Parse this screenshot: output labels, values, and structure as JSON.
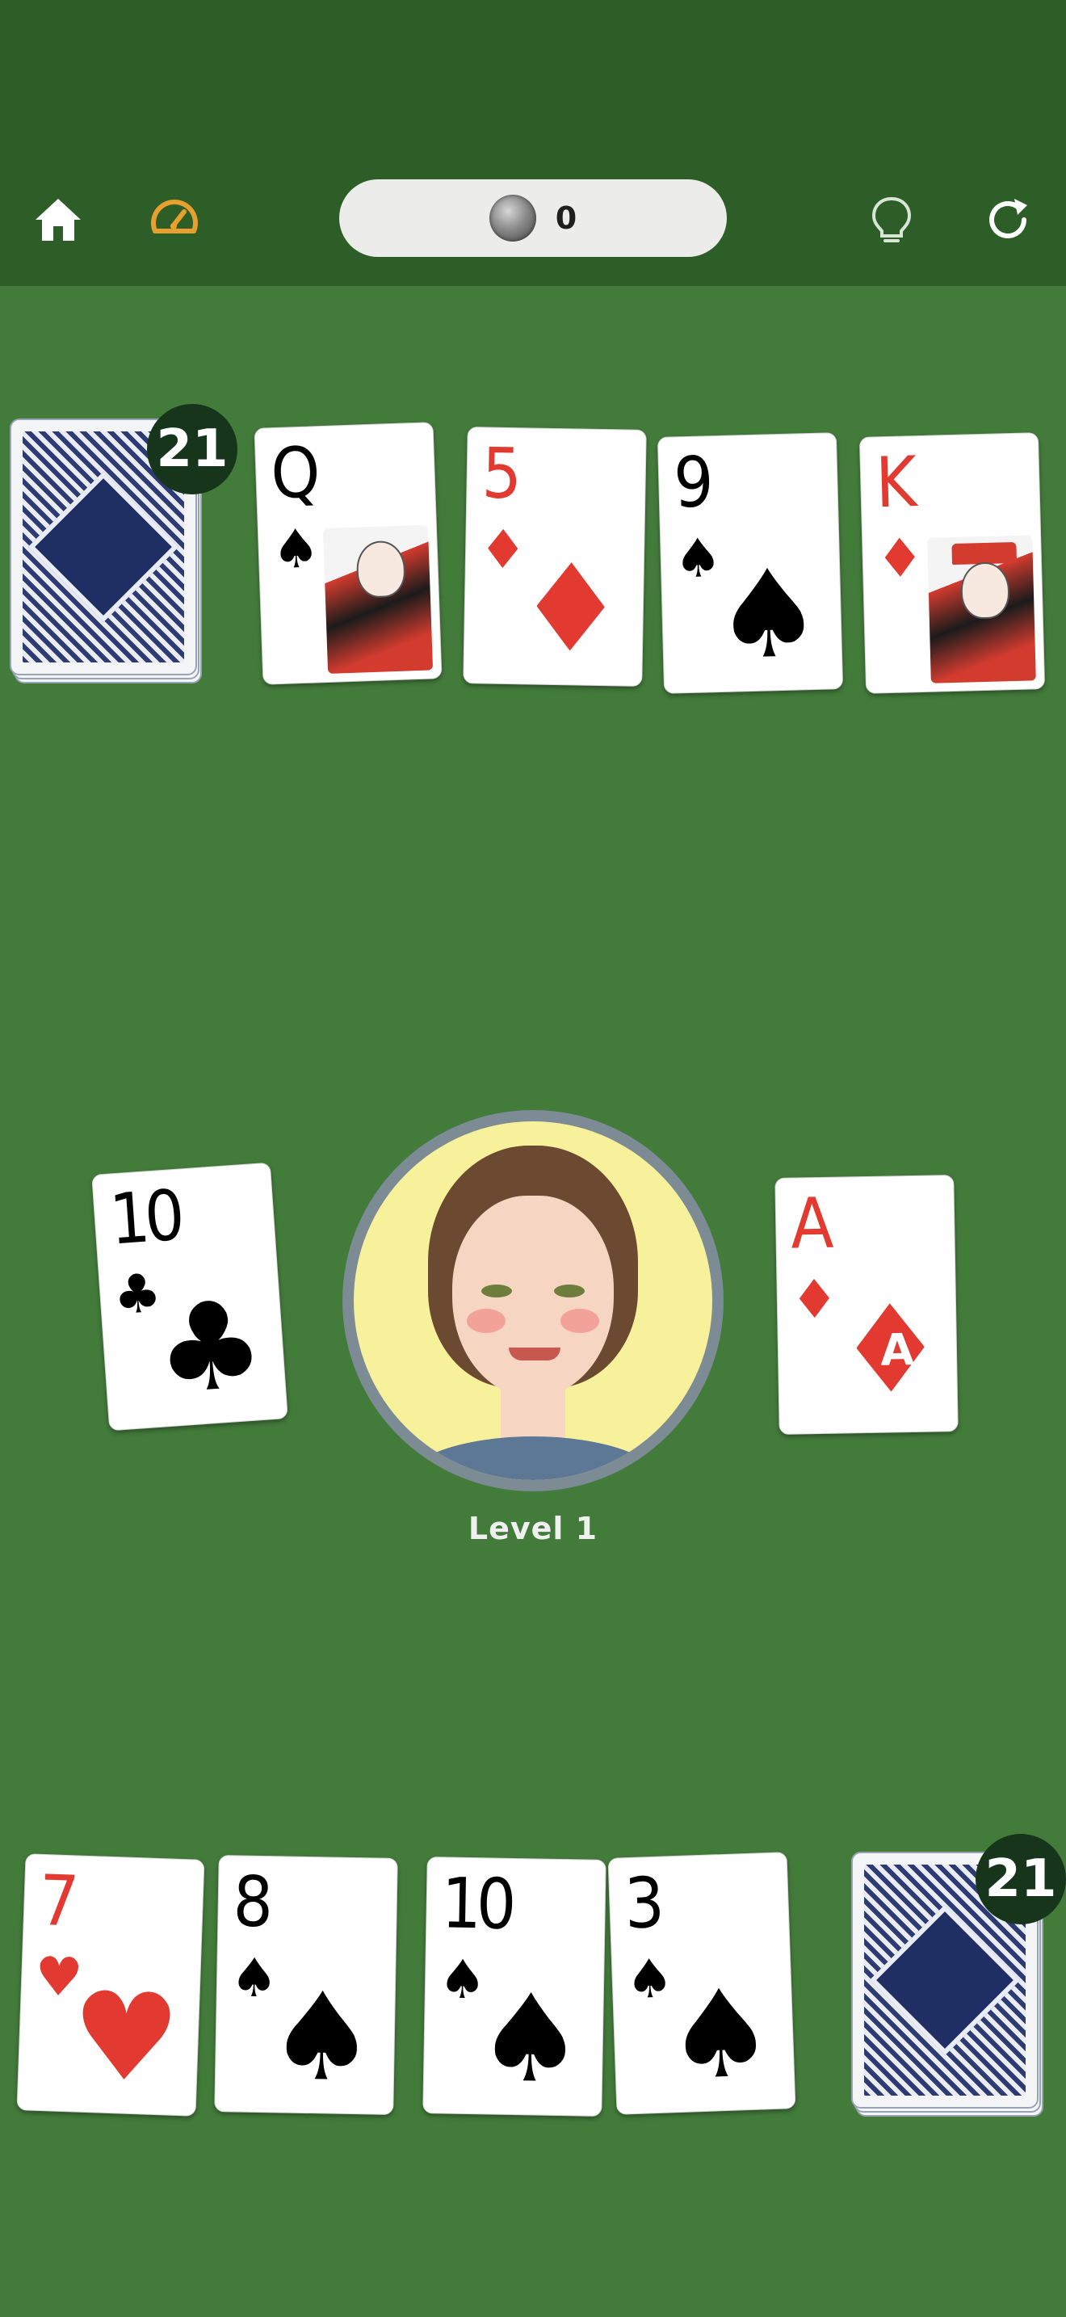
{
  "toolbar": {
    "home_icon": "home-icon",
    "speed_icon": "speedometer-icon",
    "hint_icon": "lightbulb-icon",
    "restart_icon": "refresh-icon",
    "coins": "0",
    "accent_color": "#e7a02d"
  },
  "opponent": {
    "deck_count": "21",
    "row": [
      {
        "rank": "Q",
        "suit": "♠",
        "color": "black",
        "face": true
      },
      {
        "rank": "5",
        "suit": "♦",
        "color": "red",
        "face": false
      },
      {
        "rank": "9",
        "suit": "♠",
        "color": "black",
        "face": false
      },
      {
        "rank": "K",
        "suit": "♦",
        "color": "red",
        "face": true
      }
    ]
  },
  "center": {
    "left_card": {
      "rank": "10",
      "suit": "♣",
      "color": "black"
    },
    "right_card": {
      "rank": "A",
      "suit": "♦",
      "color": "red",
      "center_glyph": "A"
    },
    "level_label": "Level 1"
  },
  "player": {
    "deck_count": "21",
    "hand": [
      {
        "rank": "7",
        "suit": "♥",
        "color": "red"
      },
      {
        "rank": "8",
        "suit": "♠",
        "color": "black"
      },
      {
        "rank": "10",
        "suit": "♠",
        "color": "black"
      },
      {
        "rank": "3",
        "suit": "♠",
        "color": "black"
      }
    ]
  }
}
